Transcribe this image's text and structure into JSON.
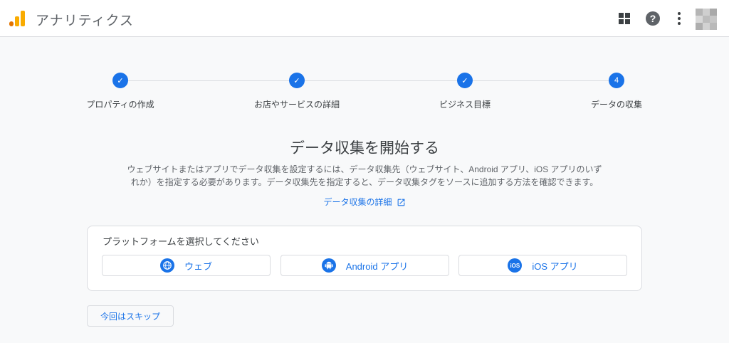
{
  "header": {
    "app_title": "アナリティクス",
    "icons": [
      "analytics-logo-icon",
      "apps-grid-icon",
      "help-icon",
      "more-vert-icon"
    ],
    "avatar_colors": [
      "#b5b5b5",
      "#cfcfcf",
      "#a9a9a9",
      "#d8d8d8",
      "#bdbdbd",
      "#c6c6c6",
      "#aeaeae",
      "#d2d2d2",
      "#b9b9b9"
    ]
  },
  "stepper": {
    "steps": [
      {
        "label": "プロパティの作成",
        "state": "done",
        "mark": "✓"
      },
      {
        "label": "お店やサービスの詳細",
        "state": "done",
        "mark": "✓"
      },
      {
        "label": "ビジネス目標",
        "state": "done",
        "mark": "✓"
      },
      {
        "label": "データの収集",
        "state": "current",
        "mark": "4"
      }
    ]
  },
  "main": {
    "heading": "データ収集を開始する",
    "description_line1": "ウェブサイトまたはアプリでデータ収集を設定するには、データ収集先（ウェブサイト、Android アプリ、iOS アプリのいず",
    "description_line2": "れか）を指定する必要があります。データ収集先を指定すると、データ収集タグをソースに追加する方法を確認できます。",
    "learn_more": "データ収集の詳細"
  },
  "platform_card": {
    "title": "プラットフォームを選択してください",
    "buttons": [
      {
        "label": "ウェブ",
        "icon": "globe-icon"
      },
      {
        "label": "Android アプリ",
        "icon": "android-icon"
      },
      {
        "label": "iOS アプリ",
        "icon": "ios-icon",
        "icon_text": "iOS"
      }
    ]
  },
  "skip_label": "今回はスキップ",
  "colors": {
    "accent": "#1a73e8",
    "logo_orange": "#f9ab00",
    "logo_dark_orange": "#e37400"
  }
}
